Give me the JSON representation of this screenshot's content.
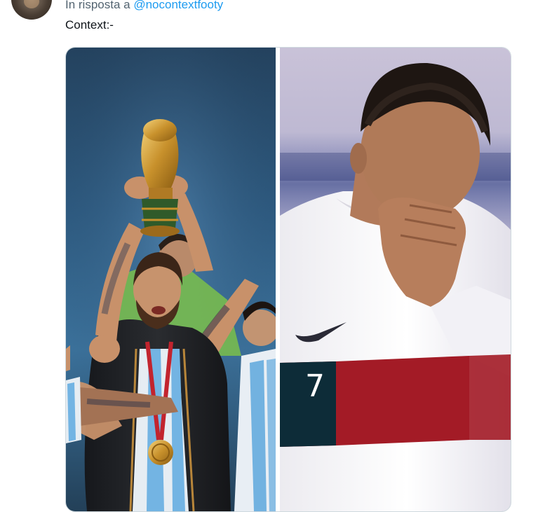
{
  "reply": {
    "prefix": "In risposta a",
    "handle": "@nocontextfooty"
  },
  "tweet": {
    "text": "Context:-"
  },
  "media": {
    "photos": [
      {
        "subject": "trophy-celebration-photo"
      },
      {
        "subject": "crying-player-photo",
        "shirt_number": "7"
      }
    ]
  },
  "colors": {
    "link": "#1d9bf0",
    "secondary_text": "#536471",
    "primary_text": "#0f1419",
    "media_border": "#cfd9de"
  }
}
